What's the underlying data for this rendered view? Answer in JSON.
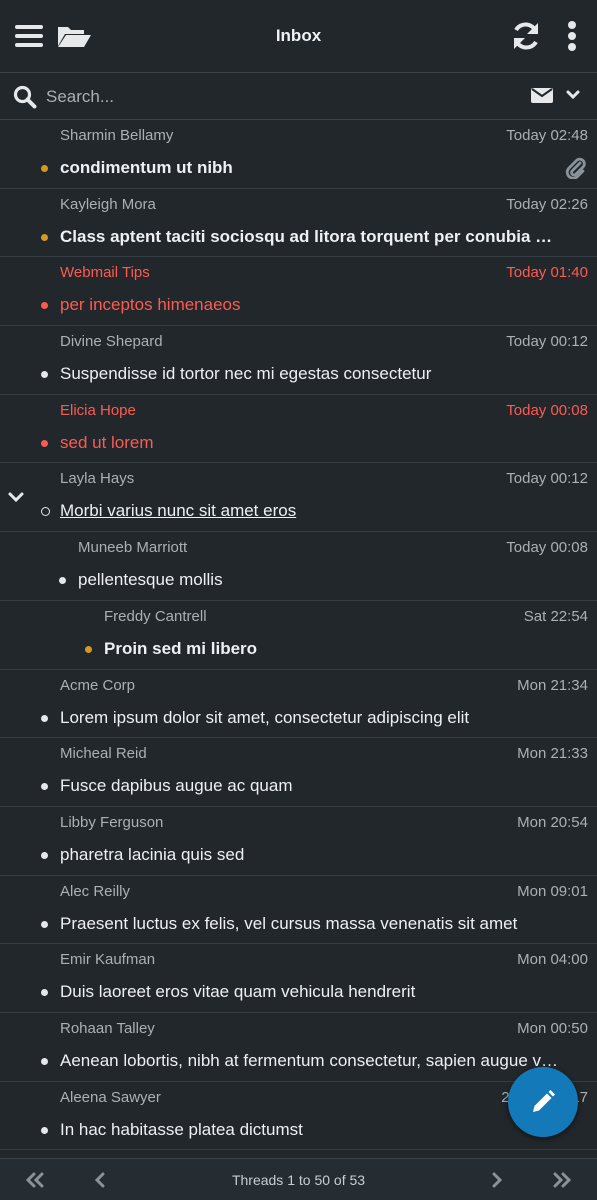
{
  "header": {
    "title": "Inbox"
  },
  "search": {
    "placeholder": "Search..."
  },
  "messages": [
    {
      "from": "Sharmin Bellamy",
      "date": "Today 02:48",
      "subject": "condimentum ut nibh",
      "state": "unread",
      "level": 0,
      "attachment": true
    },
    {
      "from": "Kayleigh Mora",
      "date": "Today 02:26",
      "subject": "Class aptent taciti sociosqu ad litora torquent per conubia nostra",
      "state": "unread",
      "level": 0
    },
    {
      "from": "Webmail Tips",
      "date": "Today 01:40",
      "subject": "per inceptos himenaeos",
      "state": "flagged",
      "level": 0
    },
    {
      "from": "Divine Shepard",
      "date": "Today 00:12",
      "subject": "Suspendisse id tortor nec mi egestas consectetur",
      "state": "read",
      "level": 0
    },
    {
      "from": "Elicia Hope",
      "date": "Today 00:08",
      "subject": "sed ut lorem",
      "state": "flagged",
      "level": 0
    },
    {
      "from": "Layla Hays",
      "date": "Today 00:12",
      "subject": "Morbi varius nunc sit amet eros",
      "state": "open",
      "level": 0,
      "expanded": true
    },
    {
      "from": "Muneeb Marriott",
      "date": "Today 00:08",
      "subject": "pellentesque mollis",
      "state": "read",
      "level": 1
    },
    {
      "from": "Freddy Cantrell",
      "date": "Sat 22:54",
      "subject": "Proin sed mi libero",
      "state": "unread",
      "level": 2
    },
    {
      "from": "Acme Corp",
      "date": "Mon 21:34",
      "subject": "Lorem ipsum dolor sit amet, consectetur adipiscing elit",
      "state": "read",
      "level": 0
    },
    {
      "from": "Micheal Reid",
      "date": "Mon 21:33",
      "subject": "Fusce dapibus augue ac quam",
      "state": "read",
      "level": 0
    },
    {
      "from": "Libby Ferguson",
      "date": "Mon 20:54",
      "subject": "pharetra lacinia quis sed",
      "state": "read",
      "level": 0
    },
    {
      "from": "Alec Reilly",
      "date": "Mon 09:01",
      "subject": "Praesent luctus ex felis, vel cursus massa venenatis sit amet",
      "state": "read",
      "level": 0
    },
    {
      "from": "Emir Kaufman",
      "date": "Mon 04:00",
      "subject": "Duis laoreet eros vitae quam vehicula hendrerit",
      "state": "read",
      "level": 0
    },
    {
      "from": "Rohaan Talley",
      "date": "Mon 00:50",
      "subject": "Aenean lobortis, nibh at fermentum consectetur, sapien augue vestibulum",
      "state": "read",
      "level": 0
    },
    {
      "from": "Aleena Sawyer",
      "date": "27 Jun 12:17",
      "subject": "In hac habitasse platea dictumst",
      "state": "read",
      "level": 0
    }
  ],
  "pager": {
    "text": "Threads 1 to 50 of 53"
  },
  "colors": {
    "unread_dot": "#d39a1f",
    "flagged": "#ff5a52",
    "fab": "#1479b8"
  },
  "icons": [
    "menu-icon",
    "folder-open-icon",
    "refresh-icon",
    "more-vertical-icon",
    "search-icon",
    "envelope-icon",
    "chevron-down-icon",
    "paperclip-icon",
    "compose-icon",
    "first-page-icon",
    "prev-page-icon",
    "next-page-icon",
    "last-page-icon"
  ]
}
